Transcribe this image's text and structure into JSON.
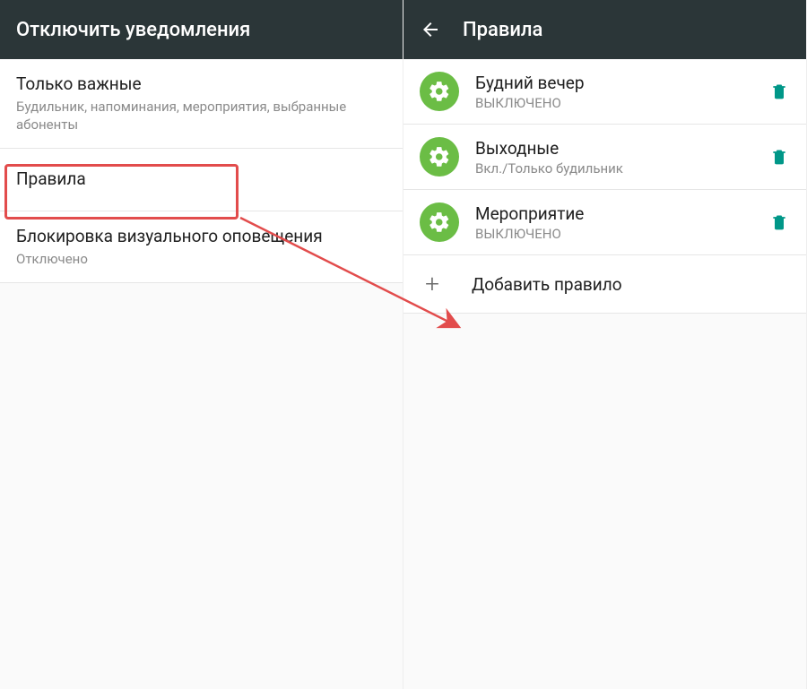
{
  "left": {
    "appbar_title": "Отключить уведомления",
    "rows": [
      {
        "primary": "Только важные",
        "secondary": "Будильник, напоминания, мероприятия, выбранные абоненты"
      },
      {
        "primary": "Правила",
        "secondary": ""
      },
      {
        "primary": "Блокировка визуального оповещения",
        "secondary": "Отключено"
      }
    ]
  },
  "right": {
    "appbar_title": "Правила",
    "rules": [
      {
        "primary": "Будний вечер",
        "secondary": "ВЫКЛЮЧЕНО"
      },
      {
        "primary": "Выходные",
        "secondary": "Вкл./Только будильник"
      },
      {
        "primary": "Мероприятие",
        "secondary": "ВЫКЛЮЧЕНО"
      }
    ],
    "add_label": "Добавить правило"
  },
  "colors": {
    "appbar_bg": "#2b3638",
    "accent_green": "#6bbd45",
    "teal": "#009788",
    "highlight_red": "#e24c4c"
  }
}
